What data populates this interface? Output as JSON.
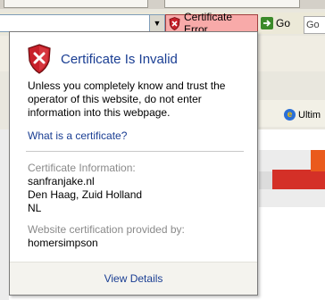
{
  "toolbar": {
    "cert_error_label": "Certificate Error",
    "go_label": "Go",
    "right_links_text": "Go",
    "tab_label": "Ultim"
  },
  "popup": {
    "title": "Certificate Is Invalid",
    "warning_text": "Unless you completely know and trust the operator of this website, do not enter information into this webpage.",
    "what_is_link": "What is a certificate?",
    "cert_info_label": "Certificate Information:",
    "cert_subject_lines": [
      "sanfranjake.nl",
      "Den Haag, Zuid Holland",
      "NL"
    ],
    "provider_label": "Website certification provided by:",
    "provider_value": "homersimpson",
    "view_details": "View Details"
  },
  "colors": {
    "link_blue": "#1a3e93",
    "error_bg": "#f8aaa9",
    "shield_red": "#c8202a"
  },
  "icons": [
    "dropdown-arrow-icon",
    "shield-error-icon",
    "go-arrow-icon",
    "ie-logo-icon"
  ]
}
